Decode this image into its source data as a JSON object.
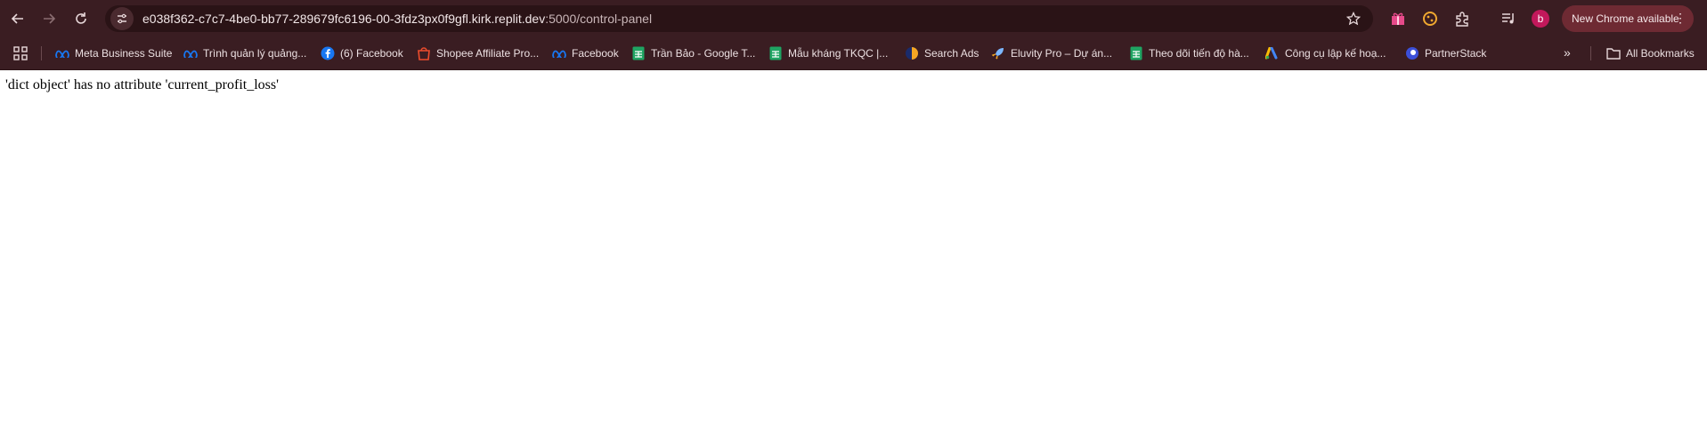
{
  "browser": {
    "url_host": "e038f362-c7c7-4be0-bb77-289679fc6196-00-3fdz3px0f9gfl.kirk.replit.dev",
    "url_path": ":5000/control-panel",
    "profile_initial": "b",
    "update_label": "New Chrome available",
    "icons": [
      "back-icon",
      "forward-icon",
      "reload-icon",
      "site-info-icon",
      "star-icon",
      "extension-icon",
      "puzzle-icon",
      "media-icon",
      "more-icon"
    ]
  },
  "bookmarks": {
    "items": [
      {
        "label": "Meta Business Suite",
        "icon": "meta-icon"
      },
      {
        "label": "Trình quản lý quảng...",
        "icon": "meta-icon"
      },
      {
        "label": "(6) Facebook",
        "icon": "facebook-icon"
      },
      {
        "label": "Shopee Affiliate Pro...",
        "icon": "shopee-icon"
      },
      {
        "label": "Facebook",
        "icon": "meta-icon"
      },
      {
        "label": "Trần Bảo - Google T...",
        "icon": "sheets-icon"
      },
      {
        "label": "Mẫu kháng TKQC |...",
        "icon": "sheets-icon"
      },
      {
        "label": "Search Ads",
        "icon": "search-ads-icon"
      },
      {
        "label": "Eluvity Pro – Dự án...",
        "icon": "rocket-icon"
      },
      {
        "label": "Theo dõi tiến độ hà...",
        "icon": "sheets-icon"
      },
      {
        "label": "Công cụ lập kế hoạ...",
        "icon": "google-ads-icon"
      },
      {
        "label": "PartnerStack",
        "icon": "partnerstack-icon"
      }
    ],
    "more_label": "»",
    "all_bookmarks_label": "All Bookmarks"
  },
  "page": {
    "error_message": "'dict object' has no attribute 'current_profit_loss'"
  }
}
